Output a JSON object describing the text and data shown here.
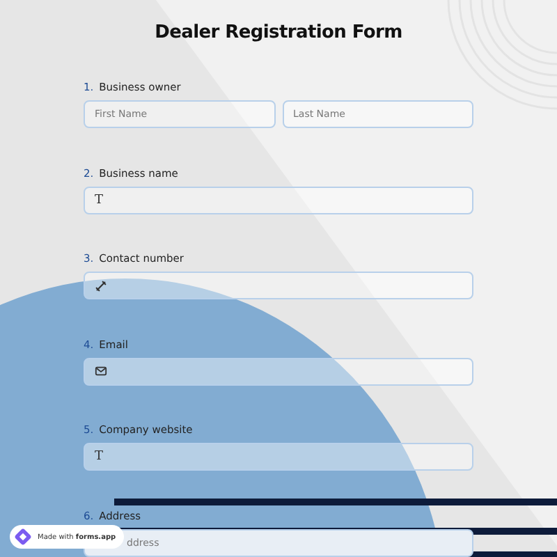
{
  "title": "Dealer Registration Form",
  "questions": [
    {
      "number": "1.",
      "label": "Business owner",
      "kind": "name",
      "placeholders": [
        "First Name",
        "Last Name"
      ]
    },
    {
      "number": "2.",
      "label": "Business name",
      "kind": "text",
      "glyph": "T"
    },
    {
      "number": "3.",
      "label": "Contact number",
      "kind": "phone"
    },
    {
      "number": "4.",
      "label": "Email",
      "kind": "email"
    },
    {
      "number": "5.",
      "label": "Company website",
      "kind": "text",
      "glyph": "T"
    },
    {
      "number": "6.",
      "label": "Address",
      "kind": "address",
      "placeholder": "ddress"
    }
  ],
  "badge": {
    "text": "Made with **forms.app**"
  }
}
